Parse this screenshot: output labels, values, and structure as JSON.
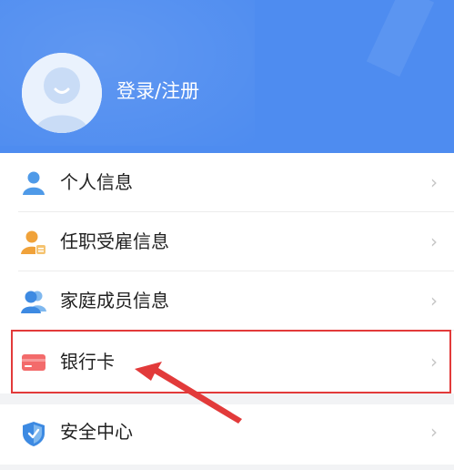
{
  "profile": {
    "login_label": "登录/注册"
  },
  "menu": {
    "items": [
      {
        "label": "个人信息",
        "icon": "person-icon"
      },
      {
        "label": "任职受雇信息",
        "icon": "employment-icon"
      },
      {
        "label": "家庭成员信息",
        "icon": "family-icon"
      },
      {
        "label": "银行卡",
        "icon": "bank-card-icon"
      }
    ],
    "chevron": "›"
  },
  "security": {
    "label": "安全中心",
    "icon": "shield-icon"
  },
  "colors": {
    "header": "#4e8cf0",
    "highlight": "#e23a3a",
    "icon_blue": "#4f9ae8",
    "icon_orange": "#f0a23a",
    "card_red": "#f36b6b"
  }
}
